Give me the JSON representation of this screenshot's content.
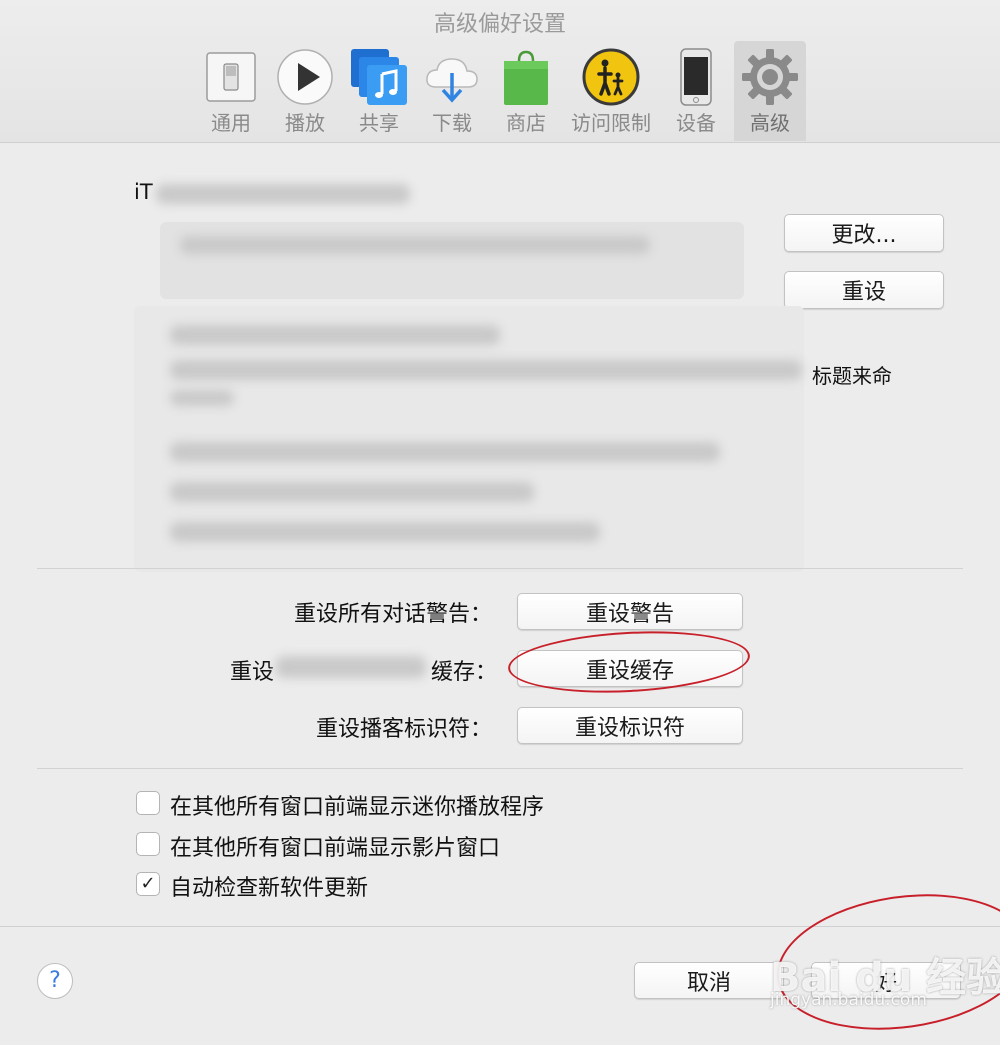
{
  "window": {
    "title": "高级偏好设置"
  },
  "toolbar": {
    "tabs": [
      {
        "label": "通用",
        "icon": "switch-icon"
      },
      {
        "label": "播放",
        "icon": "play-icon"
      },
      {
        "label": "共享",
        "icon": "music-share-icon"
      },
      {
        "label": "下载",
        "icon": "cloud-download-icon"
      },
      {
        "label": "商店",
        "icon": "shopping-bag-icon"
      },
      {
        "label": "访问限制",
        "icon": "parental-icon"
      },
      {
        "label": "设备",
        "icon": "phone-icon"
      },
      {
        "label": "高级",
        "icon": "gear-icon",
        "active": true
      }
    ]
  },
  "media_folder": {
    "label_visible": "iT",
    "change_label": "更改...",
    "reset_label": "重设",
    "partial_text": "标题来命"
  },
  "resets": {
    "dialog_label": "重设所有对话警告：",
    "dialog_button": "重设警告",
    "cache_label_start": "重设",
    "cache_label_end": "缓存：",
    "cache_button": "重设缓存",
    "podcast_label": "重设播客标识符：",
    "podcast_button": "重设标识符"
  },
  "options": [
    {
      "label": "在其他所有窗口前端显示迷你播放程序",
      "checked": false
    },
    {
      "label": "在其他所有窗口前端显示影片窗口",
      "checked": false
    },
    {
      "label": "自动检查新软件更新",
      "checked": true
    }
  ],
  "footer": {
    "help_label": "?",
    "cancel_label": "取消",
    "ok_label": "好"
  },
  "watermark": {
    "brand": "Bai du 经验",
    "url": "jingyan.baidu.com"
  },
  "colors": {
    "annotation": "#c8202a",
    "help_accent": "#3b7be0"
  }
}
